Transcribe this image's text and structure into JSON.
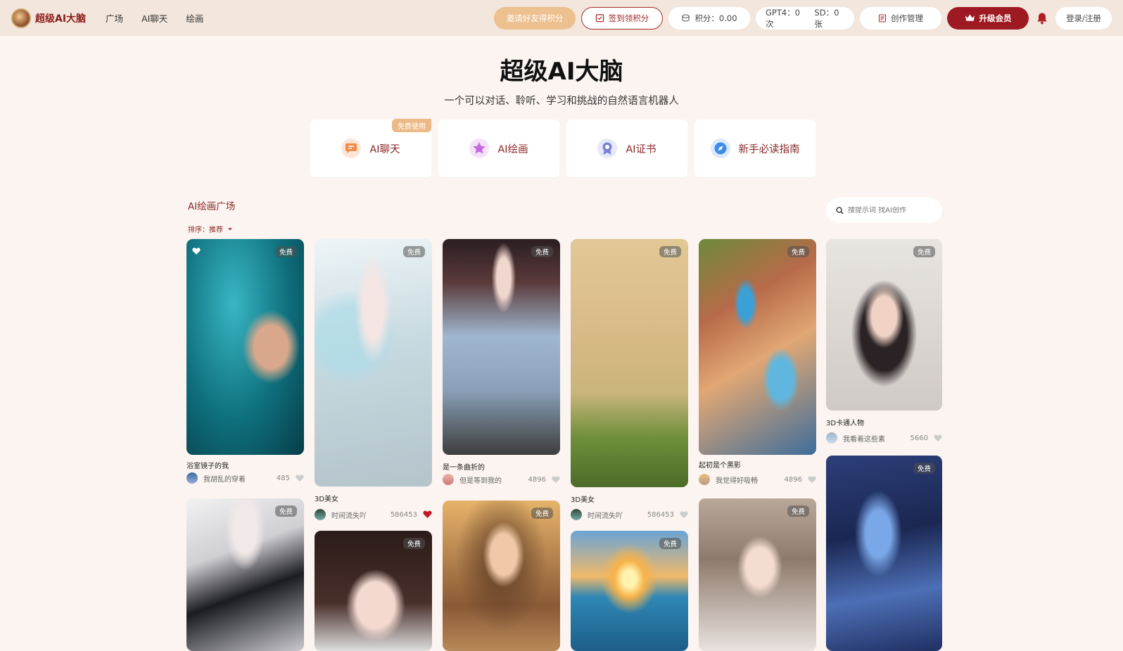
{
  "header": {
    "logo_text": "超级AI大脑",
    "nav": [
      "广场",
      "AI聊天",
      "绘画"
    ],
    "invite_label": "邀请好友得积分",
    "checkin_label": "签到领积分",
    "points_label": "积分：0.00",
    "gpt4_label": "GPT4：0次",
    "sd_label": "SD：0张",
    "manage_label": "创作管理",
    "vip_label": "升级会员",
    "login_label": "登录/注册"
  },
  "hero": {
    "title": "超级AI大脑",
    "subtitle": "一个可以对话、聆听、学习和挑战的自然语言机器人"
  },
  "features": [
    {
      "label": "AI聊天",
      "icon": "chat-icon",
      "badge": "免费使用",
      "color": "#f08a4b"
    },
    {
      "label": "AI绘画",
      "icon": "paint-star-icon",
      "color": "#c66adb"
    },
    {
      "label": "AI证书",
      "icon": "certificate-icon",
      "color": "#7a7fd6"
    },
    {
      "label": "新手必读指南",
      "icon": "compass-icon",
      "color": "#3d8de8"
    }
  ],
  "gallery": {
    "section_title": "AI绘画广场",
    "sort_label": "排序：推荐",
    "search_placeholder": "搜提示词 找AI创作",
    "badge": "免费",
    "cards": [
      {
        "title": "浴室镜子的我",
        "author": "我胡乱的穿着",
        "likes": "485",
        "liked": false
      },
      {
        "title": "3D美女",
        "author": "时间流失吖",
        "likes": "586453",
        "liked": true
      },
      {
        "title": "是一条曲折的",
        "author": "但是等到我的",
        "likes": "4896",
        "liked": false
      },
      {
        "title": "3D美女",
        "author": "时间流失吖",
        "likes": "586453",
        "liked": false
      },
      {
        "title": "起初是个黑影",
        "author": "我觉得好吸畅",
        "likes": "4896",
        "liked": false
      },
      {
        "title": "3D卡通人物",
        "author": "我看着这些素",
        "likes": "5660",
        "liked": false
      }
    ]
  },
  "colors": {
    "brand": "#8b1a1a",
    "vip": "#9e1a22",
    "invite": "#edc08f",
    "background": "#fbf4f0"
  }
}
